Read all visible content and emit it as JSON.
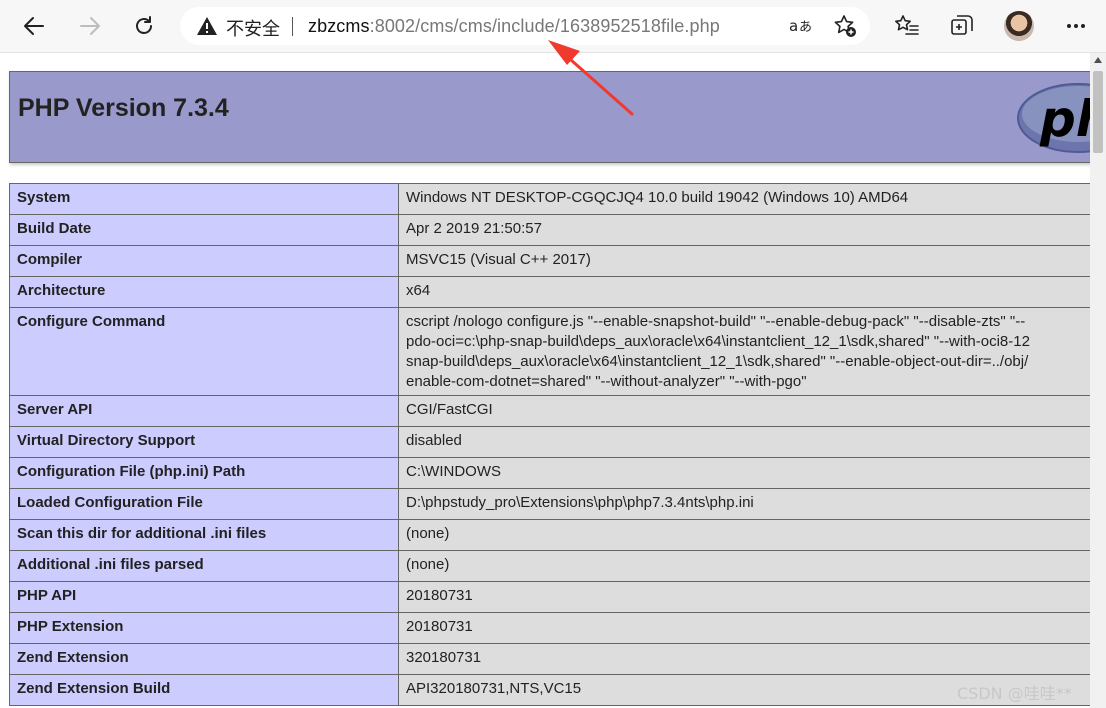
{
  "browser": {
    "security_label": "不安全",
    "url": {
      "host": "zbzcms",
      "rest": ":8002/cms/cms/include/1638952518file.php"
    }
  },
  "phpinfo": {
    "title": "PHP Version 7.3.4",
    "rows": [
      {
        "key": "System",
        "value": "Windows NT DESKTOP-CGQCJQ4 10.0 build 19042 (Windows 10) AMD64"
      },
      {
        "key": "Build Date",
        "value": "Apr 2 2019 21:50:57"
      },
      {
        "key": "Compiler",
        "value": "MSVC15 (Visual C++ 2017)"
      },
      {
        "key": "Architecture",
        "value": "x64"
      },
      {
        "key": "Configure Command",
        "value_lines": [
          "cscript /nologo configure.js \"--enable-snapshot-build\" \"--enable-debug-pack\" \"--disable-zts\" \"--",
          "pdo-oci=c:\\php-snap-build\\deps_aux\\oracle\\x64\\instantclient_12_1\\sdk,shared\" \"--with-oci8-12",
          "snap-build\\deps_aux\\oracle\\x64\\instantclient_12_1\\sdk,shared\" \"--enable-object-out-dir=../obj/",
          "enable-com-dotnet=shared\" \"--without-analyzer\" \"--with-pgo\""
        ]
      },
      {
        "key": "Server API",
        "value": "CGI/FastCGI"
      },
      {
        "key": "Virtual Directory Support",
        "value": "disabled"
      },
      {
        "key": "Configuration File (php.ini) Path",
        "value": "C:\\WINDOWS"
      },
      {
        "key": "Loaded Configuration File",
        "value": "D:\\phpstudy_pro\\Extensions\\php\\php7.3.4nts\\php.ini"
      },
      {
        "key": "Scan this dir for additional .ini files",
        "value": "(none)"
      },
      {
        "key": "Additional .ini files parsed",
        "value": "(none)"
      },
      {
        "key": "PHP API",
        "value": "20180731"
      },
      {
        "key": "PHP Extension",
        "value": "20180731"
      },
      {
        "key": "Zend Extension",
        "value": "320180731"
      },
      {
        "key": "Zend Extension Build",
        "value": "API320180731,NTS,VC15"
      }
    ]
  },
  "watermark": "CSDN @哇哇**"
}
